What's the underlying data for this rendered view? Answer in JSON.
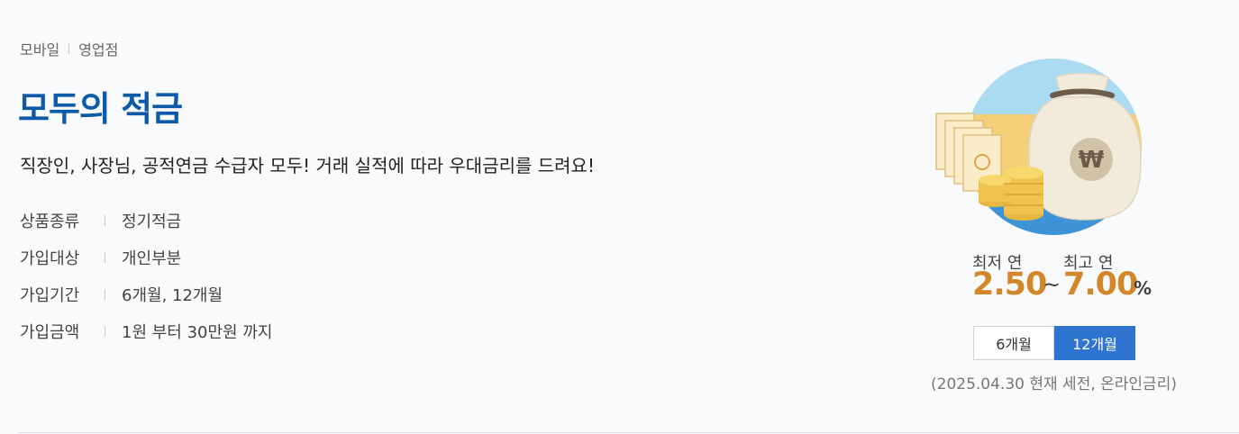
{
  "channels": [
    "모바일",
    "영업점"
  ],
  "product": {
    "title": "모두의 적금",
    "description": "직장인, 사장님, 공적연금 수급자 모두! 거래 실적에 따라 우대금리를 드려요!"
  },
  "info": [
    {
      "label": "상품종류",
      "value": "정기적금"
    },
    {
      "label": "가입대상",
      "value": "개인부분"
    },
    {
      "label": "가입기간",
      "value": "6개월, 12개월"
    },
    {
      "label": "가입금액",
      "value": "1원 부터 30만원 까지"
    }
  ],
  "rate": {
    "min_label": "최저 연",
    "min_value": "2.50",
    "separator": "~",
    "max_label": "최고 연",
    "max_value": "7.00",
    "unit": "%"
  },
  "term_tabs": [
    {
      "label": "6개월",
      "selected": false
    },
    {
      "label": "12개월",
      "selected": true
    }
  ],
  "rate_note": "(2025.04.30 현재 세전, 온라인금리)",
  "illustration_icon": "money-bag-coins-icon",
  "colors": {
    "title": "#0d5aa8",
    "rate_number": "#d4862a",
    "active_tab": "#2f74d0"
  }
}
